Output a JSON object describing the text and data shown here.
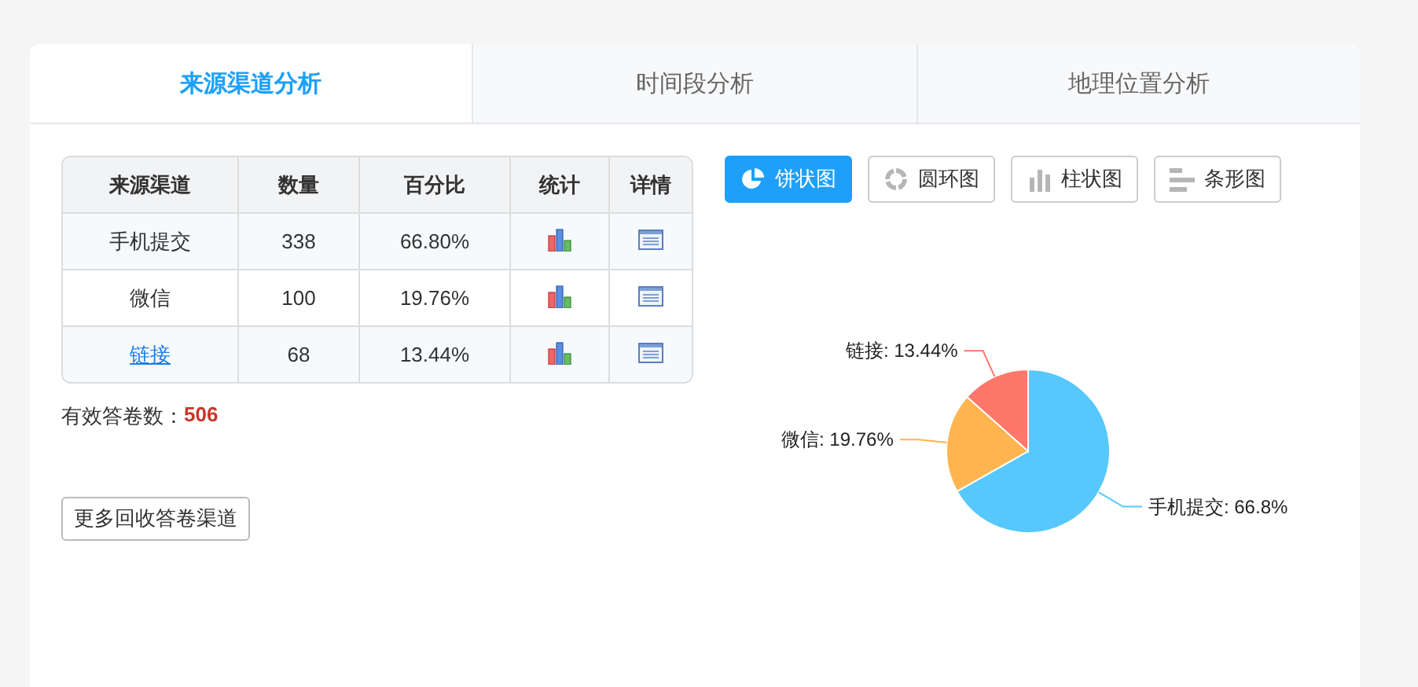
{
  "tabs": [
    {
      "label": "来源渠道分析",
      "selected": true
    },
    {
      "label": "时间段分析",
      "selected": false
    },
    {
      "label": "地理位置分析",
      "selected": false
    }
  ],
  "table": {
    "columns": [
      "来源渠道",
      "数量",
      "百分比",
      "统计",
      "详情"
    ],
    "rows": [
      {
        "channel": "手机提交",
        "kind": "text",
        "count": "338",
        "percent": "66.80%"
      },
      {
        "channel": "微信",
        "kind": "text",
        "count": "100",
        "percent": "19.76%"
      },
      {
        "channel": "链接",
        "kind": "link",
        "count": "68",
        "percent": "13.44%"
      }
    ]
  },
  "total": {
    "label": "有效答卷数：",
    "value": "506"
  },
  "more_button": "更多回收答卷渠道",
  "chart_types": [
    {
      "label": "饼状图",
      "kind": "pie",
      "selected": true
    },
    {
      "label": "圆环图",
      "kind": "donut",
      "selected": false
    },
    {
      "label": "柱状图",
      "kind": "bar",
      "selected": false
    },
    {
      "label": "条形图",
      "kind": "hbar",
      "selected": false
    }
  ],
  "chart_data": {
    "type": "pie",
    "categories": [
      "手机提交",
      "微信",
      "链接"
    ],
    "values": [
      66.8,
      19.76,
      13.44
    ],
    "colors": [
      "#56c8fd",
      "#feb54f",
      "#ff776a"
    ],
    "value_labels": [
      "66.8%",
      "19.76%",
      "13.44%"
    ]
  },
  "pie_label_separator": ": "
}
